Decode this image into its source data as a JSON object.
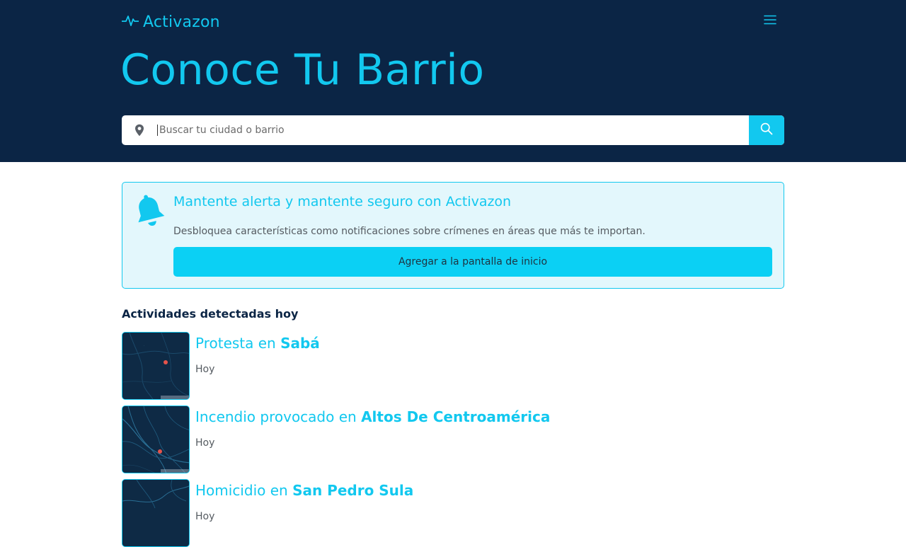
{
  "header": {
    "logo_text": "Activazon",
    "logo_icon": "pulse-icon",
    "menu_icon": "hamburger-menu-icon",
    "hero_title": "Conoce Tu Barrio"
  },
  "search": {
    "placeholder": "Buscar tu ciudad o barrio",
    "value": "",
    "pin_icon": "map-pin-icon",
    "button_icon": "search-icon"
  },
  "alert": {
    "icon": "bell-icon",
    "title": "Mantente alerta y mantente seguro con Activazon",
    "description": "Desbloquea características como notificaciones sobre crímenes en áreas que más te importan.",
    "button_label": "Agregar a la pantalla de inicio"
  },
  "activities": {
    "section_title": "Actividades detectadas hoy",
    "items": [
      {
        "type": "Protesta en",
        "place": "Sabá",
        "date": "Hoy"
      },
      {
        "type": "Incendio provocado en",
        "place": "Altos De Centroamérica",
        "date": "Hoy"
      },
      {
        "type": "Homicidio en",
        "place": "San Pedro Sula",
        "date": "Hoy"
      }
    ]
  },
  "colors": {
    "header_bg": "#0b2545",
    "accent": "#12c8ef",
    "alert_bg": "#e3f7fc",
    "marker": "#e5534b"
  }
}
